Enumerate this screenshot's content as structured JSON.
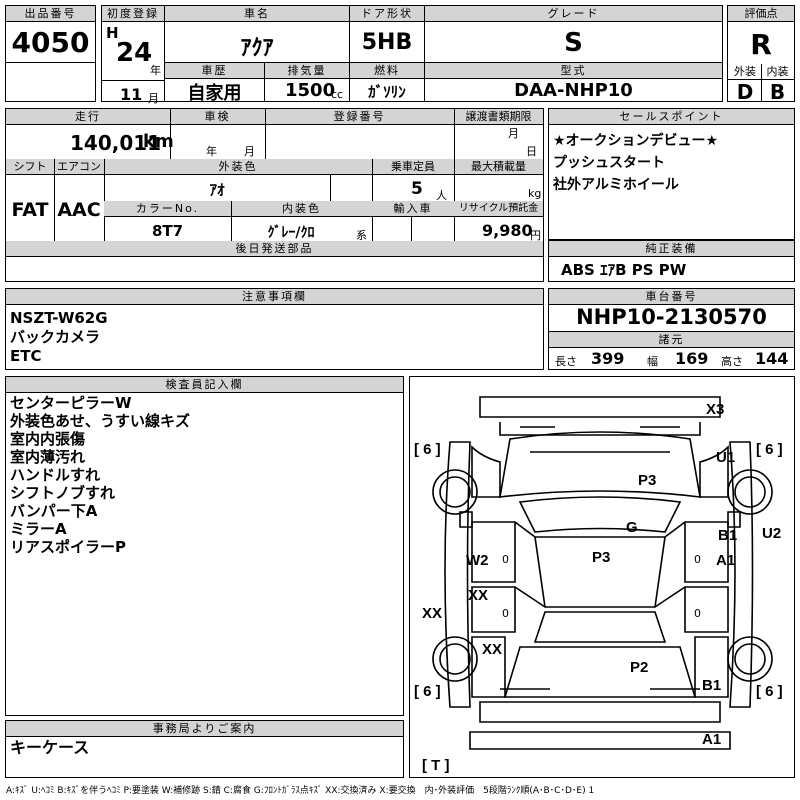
{
  "labels": {
    "lot_no": "出品番号",
    "first_reg": "初度登録",
    "car_name": "車名",
    "door_type": "ドア形状",
    "grade": "グレード",
    "score": "評価点",
    "car_history": "車歴",
    "displacement": "排気量",
    "fuel": "燃料",
    "model_code": "型式",
    "exterior": "外装",
    "interior": "内装",
    "mileage": "走行",
    "inspection": "車検",
    "reg_no": "登録番号",
    "transfer_deadline": "譲渡書類期限",
    "sales_point": "セールスポイント",
    "shift": "シフト",
    "aircon": "エアコン",
    "ext_color": "外装色",
    "capacity": "乗車定員",
    "max_load": "最大積載量",
    "color_no": "カラーNo.",
    "int_color": "内装色",
    "import": "輸入車",
    "recycle": "リサイクル預託金",
    "later_parts": "後日発送部品",
    "genuine_equip": "純正装備",
    "caution": "注意事項欄",
    "chassis_no": "車台番号",
    "specs": "諸元",
    "inspector_notes": "検査員記入欄",
    "office_notice": "事務局よりご案内"
  },
  "units": {
    "year": "年",
    "month": "月",
    "cc": "cc",
    "km": "km",
    "persons": "人",
    "kg": "kg",
    "kei": "系",
    "yen": "円",
    "length": "長さ",
    "width": "幅",
    "height": "高さ"
  },
  "values": {
    "lot_no": "4050",
    "era": "H",
    "reg_year": "24",
    "reg_month": "11",
    "car_name": "ｱｸｱ",
    "door_type": "5HB",
    "grade": "S",
    "score": "R",
    "car_history": "自家用",
    "displacement": "1500",
    "fuel": "ｶﾞｿﾘﾝ",
    "model_code": "DAA-NHP10",
    "exterior_grade": "D",
    "interior_grade": "B",
    "mileage": "140,011",
    "shift": "FAT",
    "aircon": "AAC",
    "ext_color": "ｱｵ",
    "capacity": "5",
    "color_no": "8T7",
    "int_color": "ｸﾞﾚｰ/ｸﾛ",
    "recycle": "9,980",
    "genuine_equip": "ABS ｴｱB PS PW",
    "chassis_no": "NHP10-2130570",
    "length": "399",
    "width": "169",
    "height": "144"
  },
  "sales_points": [
    "★オークションデビュー★",
    "プッシュスタート",
    "社外アルミホイール"
  ],
  "caution_lines": [
    "NSZT-W62G",
    "バックカメラ",
    "ETC"
  ],
  "inspector_lines": [
    "センターピラーW",
    "外装色あせ、うすい線キズ",
    "室内内張傷",
    "室内薄汚れ",
    "ハンドルすれ",
    "シフトノブすれ",
    "バンパー下A",
    "ミラーA",
    "リアスポイラーP"
  ],
  "office_lines": [
    "キーケース"
  ],
  "diagram": {
    "X3": "X3",
    "U1": "U1",
    "U2": "U2",
    "P3a": "P3",
    "G": "G",
    "B1a": "B1",
    "A1a": "A1",
    "W2": "W2",
    "P3b": "P3",
    "XXa": "XX",
    "XXb": "XX",
    "XXc": "XX",
    "P2": "P2",
    "B1b": "B1",
    "A1b": "A1",
    "tyre_fl": "[ 6 ]",
    "tyre_fr": "[ 6 ]",
    "tyre_rl": "[ 6 ]",
    "tyre_rr": "[ 6 ]",
    "spare": "[ T ]",
    "zero": "0"
  },
  "legend": "A:ｷｽﾞ U:ﾍｺﾐ B:ｷｽﾞを伴うﾍｺﾐ P:要塗装 W:補修跡 S:錆 C:腐食 G:ﾌﾛﾝﾄｶﾞﾗｽ点ｷｽﾞ XX:交換済み X:要交換　内･外装評価　5段階ﾗﾝｸ順(A･B･C･D･E) 1"
}
